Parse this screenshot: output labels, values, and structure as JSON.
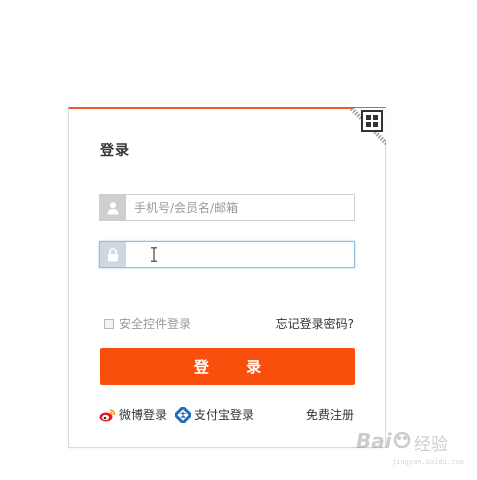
{
  "login": {
    "title": "登录",
    "username_placeholder": "手机号/会员名/邮箱",
    "password_value": "",
    "safe_control_label": "安全控件登录",
    "forgot_label": "忘记登录密码?",
    "submit_label": "登 录",
    "weibo_label": "微博登录",
    "alipay_label": "支付宝登录",
    "register_label": "免费注册"
  },
  "icons": {
    "qr": "qr-code-icon",
    "user": "user-icon",
    "lock": "lock-icon",
    "weibo": "weibo-icon",
    "alipay": "alipay-icon",
    "caret": "text-cursor-icon"
  },
  "colors": {
    "accent": "#f84f0d",
    "top_border": "#f05a28",
    "focus_border": "#8fc1e4"
  },
  "watermark": {
    "text": "Bai 经验"
  }
}
